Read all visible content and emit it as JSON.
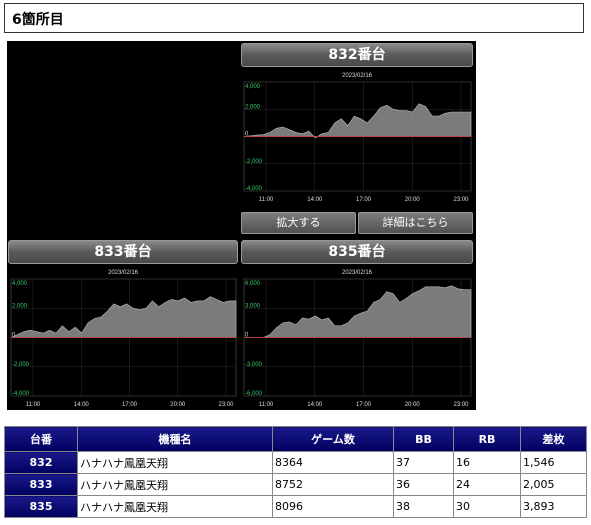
{
  "section_title": "6箇所目",
  "charts": [
    {
      "header": "832番台",
      "date": "2023/02/16",
      "y_ticks": [
        "4,000",
        "2,000",
        "0",
        "-2,000",
        "-4,000"
      ],
      "x_ticks": [
        "11:00",
        "14:00",
        "17:00",
        "20:00",
        "23:00"
      ],
      "ylim": [
        -4000,
        4000
      ],
      "values": [
        0,
        50,
        100,
        150,
        300,
        600,
        700,
        500,
        300,
        200,
        400,
        -100,
        200,
        300,
        1000,
        1300,
        800,
        1500,
        1300,
        1000,
        1500,
        2100,
        2300,
        2000,
        1900,
        1900,
        1800,
        2400,
        2200,
        1500,
        1500,
        1700,
        1800,
        1800,
        1800,
        1800
      ]
    },
    {
      "header": "833番台",
      "date": "2023/02/16",
      "y_ticks": [
        "4,000",
        "2,000",
        "0",
        "-2,000",
        "-4,000"
      ],
      "x_ticks": [
        "11:00",
        "14:00",
        "17:00",
        "20:00",
        "23:00"
      ],
      "ylim": [
        -4000,
        4000
      ],
      "values": [
        0,
        200,
        400,
        500,
        400,
        300,
        500,
        300,
        800,
        400,
        700,
        300,
        1000,
        1300,
        1400,
        1800,
        2300,
        2100,
        2300,
        2000,
        1900,
        2000,
        2500,
        2100,
        2400,
        2600,
        2500,
        2700,
        2400,
        2500,
        2500,
        2800,
        2600,
        2400,
        2500,
        2500
      ]
    },
    {
      "header": "835番台",
      "date": "2023/02/16",
      "y_ticks": [
        "6,000",
        "3,000",
        "0",
        "-3,000",
        "-6,000"
      ],
      "x_ticks": [
        "11:00",
        "14:00",
        "17:00",
        "20:00",
        "23:00"
      ],
      "ylim": [
        -6000,
        6000
      ],
      "values": [
        0,
        0,
        0,
        0,
        300,
        1000,
        1500,
        1600,
        1300,
        2000,
        1900,
        2200,
        1800,
        2000,
        1200,
        1200,
        1500,
        2200,
        2500,
        2700,
        3600,
        3900,
        4700,
        4500,
        3600,
        4000,
        4500,
        4800,
        5200,
        5200,
        5200,
        5100,
        5300,
        5000,
        4900,
        4900
      ]
    }
  ],
  "buttons": {
    "zoom": "拡大する",
    "details": "詳細はこちら"
  },
  "table": {
    "headers": [
      "台番",
      "機種名",
      "ゲーム数",
      "BB",
      "RB",
      "差枚"
    ],
    "rows": [
      [
        "832",
        "ハナハナ鳳凰天翔",
        "8364",
        "37",
        "16",
        "1,546"
      ],
      [
        "833",
        "ハナハナ鳳凰天翔",
        "8752",
        "36",
        "24",
        "2,005"
      ],
      [
        "835",
        "ハナハナ鳳凰天翔",
        "8096",
        "38",
        "30",
        "3,893"
      ]
    ]
  },
  "colors": {
    "tick_positive": "#33cc66",
    "zero_line": "#cc3333",
    "area_fill": "#888888",
    "header_bg": "#000060"
  }
}
